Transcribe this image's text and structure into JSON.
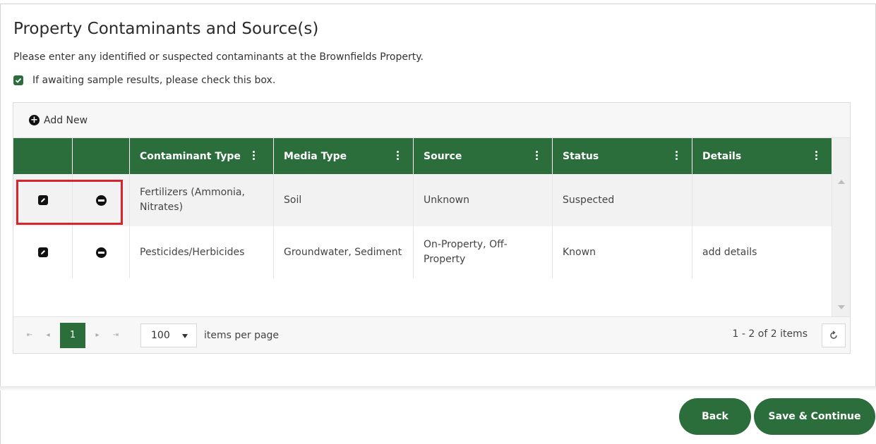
{
  "page": {
    "title": "Property Contaminants and Source(s)",
    "intro": "Please enter any identified or suspected contaminants at the Brownfields Property.",
    "checkbox_label": "If awaiting sample results, please check this box.",
    "checkbox_checked": true
  },
  "grid": {
    "add_new_label": "Add New",
    "columns": [
      {
        "label": ""
      },
      {
        "label": ""
      },
      {
        "label": "Contaminant Type"
      },
      {
        "label": "Media Type"
      },
      {
        "label": "Source"
      },
      {
        "label": "Status"
      },
      {
        "label": "Details"
      }
    ],
    "rows": [
      {
        "contaminant_type": "Fertilizers (Ammonia, Nitrates)",
        "media_type": "Soil",
        "source": "Unknown",
        "status": "Suspected",
        "details": ""
      },
      {
        "contaminant_type": "Pesticides/Herbicides",
        "media_type": "Groundwater, Sediment",
        "source": "On-Property, Off-Property",
        "status": "Known",
        "details": "add details"
      }
    ]
  },
  "pager": {
    "current_page": "1",
    "page_size": "100",
    "items_per_page_label": "items per page",
    "info": "1 - 2 of 2 items"
  },
  "footer": {
    "back_label": "Back",
    "save_label": "Save & Continue"
  },
  "colors": {
    "brand_green": "#2b6e3b",
    "highlight_red": "#d9232d"
  },
  "icons": [
    "check-icon",
    "plus-circle-icon",
    "column-menu-icon",
    "edit-icon",
    "remove-icon",
    "first-page-icon",
    "prev-page-icon",
    "next-page-icon",
    "last-page-icon",
    "dropdown-caret-icon",
    "refresh-icon"
  ]
}
